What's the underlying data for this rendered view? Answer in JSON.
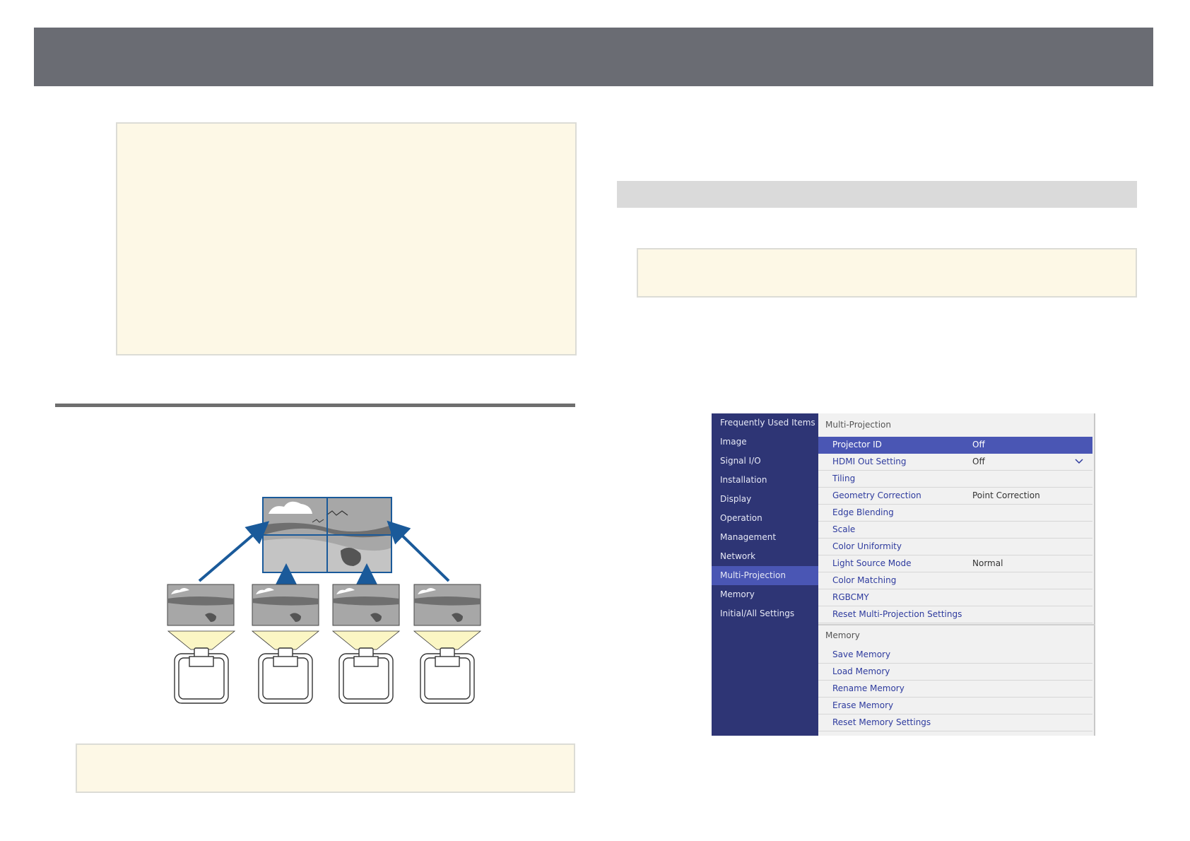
{
  "menu": {
    "sidebar": [
      "Frequently Used Items",
      "Image",
      "Signal I/O",
      "Installation",
      "Display",
      "Operation",
      "Management",
      "Network",
      "Multi-Projection",
      "Memory",
      "Initial/All Settings"
    ],
    "section1_title": "Multi-Projection",
    "section1_rows": [
      {
        "label": "Projector ID",
        "value": "Off"
      },
      {
        "label": "HDMI Out Setting",
        "value": "Off"
      },
      {
        "label": "Tiling",
        "value": ""
      },
      {
        "label": "Geometry Correction",
        "value": "Point Correction"
      },
      {
        "label": "Edge Blending",
        "value": ""
      },
      {
        "label": "Scale",
        "value": ""
      },
      {
        "label": "Color Uniformity",
        "value": ""
      },
      {
        "label": "Light Source Mode",
        "value": "Normal"
      },
      {
        "label": "Color Matching",
        "value": ""
      },
      {
        "label": "RGBCMY",
        "value": ""
      },
      {
        "label": "Reset Multi-Projection Settings",
        "value": ""
      }
    ],
    "section2_title": "Memory",
    "section2_rows": [
      {
        "label": "Save Memory"
      },
      {
        "label": "Load Memory"
      },
      {
        "label": "Rename Memory"
      },
      {
        "label": "Erase Memory"
      },
      {
        "label": "Reset Memory Settings"
      }
    ],
    "active_sidebar_index": 8,
    "selected_row_index": 0
  },
  "colors": {
    "header": "#6a6c73",
    "note_background": "#fdf8e6",
    "menu_sidebar": "#2e3575",
    "menu_highlight": "#4a56b4",
    "arrow_blue": "#1a5a9a"
  }
}
